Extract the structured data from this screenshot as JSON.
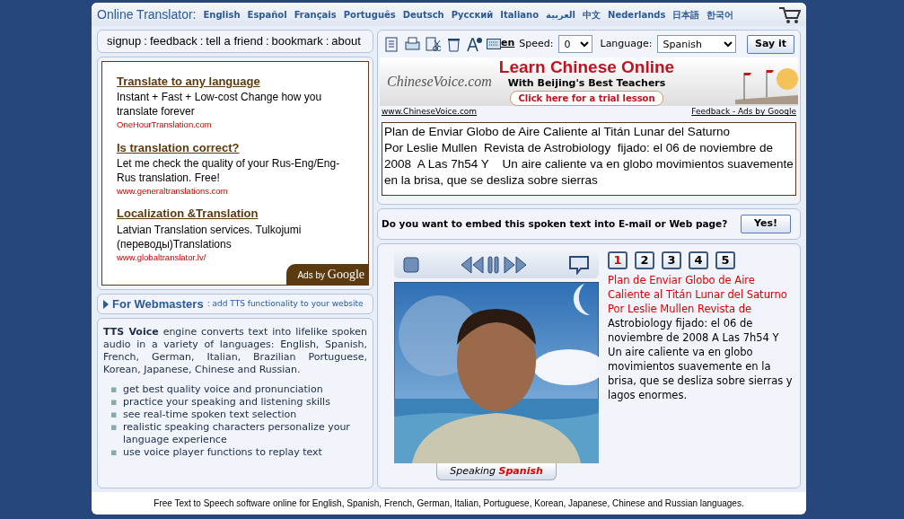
{
  "header": {
    "title": "Online Translator:",
    "languages": [
      "English",
      "Español",
      "Français",
      "Português",
      "Deutsch",
      "Русский",
      "Italiano",
      "العربية",
      "中文",
      "Nederlands",
      "日本語",
      "한국어"
    ]
  },
  "top_links": {
    "separator": ":",
    "items": [
      "signup",
      "feedback",
      "tell a friend",
      "bookmark",
      "about"
    ]
  },
  "ads": [
    {
      "title": "Translate to any language",
      "text": "Instant + Fast + Low-cost Change how you translate forever",
      "url": "OneHourTranslation.com"
    },
    {
      "title": "Is translation correct?",
      "text": "Let me check the quality of your Rus-Eng/Eng-Rus translation. Free!",
      "url": "www.generaltranslations.com"
    },
    {
      "title": "Localization &Translation",
      "text": "Latvian Translation services. Tulkojumi (переводы)Translations",
      "url": "www.globaltranslator.lv/"
    }
  ],
  "ads_badge": {
    "prefix": "Ads by",
    "brand": "Google"
  },
  "webmasters": {
    "title": "For Webmasters",
    "subtitle": ": add TTS functionality to your website"
  },
  "tts_info": {
    "intro": "**TTS Voice** engine converts text into lifelike spoken audio in a variety of languages: English, Spanish, French, German, Italian, Brazilian Portuguese, Korean, Japanese, Chinese and Russian.",
    "bullet": "▪",
    "features": [
      "get best quality voice and pronunciation",
      "practice your speaking and listening skills",
      "see real-time spoken text selection",
      "realistic speaking characters personalize your language experience",
      "use voice player functions to replay text"
    ]
  },
  "toolbar": {
    "keyboard_label": "en",
    "speed_label": "Speed:",
    "speed": "0",
    "language_label": "Language:",
    "language": "Spanish",
    "say_button": "Say it"
  },
  "banner": {
    "site": "ChineseVoice.com",
    "headline": "Learn Chinese Online",
    "tagline": "With Beijing's Best Teachers",
    "cta": "Click here for a trial lesson",
    "left_link": "www.ChineseVoice.com",
    "right_link": "Feedback - Ads by Google"
  },
  "text_input": {
    "value": "Plan de Enviar Globo de Aire Caliente al Titán Lunar del Saturno\nPor Leslie Mullen  Revista de Astrobiology  fijado: el 06 de noviembre de 2008  A Las 7h54 Y    Un aire caliente va en globo movimientos suavemente en la brisa, que se desliza sobre sierras"
  },
  "embed": {
    "question": "Do you want to embed this spoken text into E-mail or Web page?",
    "button": "Yes!"
  },
  "player": {
    "pages": [
      {
        "label": "1",
        "selected": true
      },
      {
        "label": "2",
        "selected": false
      },
      {
        "label": "3",
        "selected": false
      },
      {
        "label": "4",
        "selected": false
      },
      {
        "label": "5",
        "selected": false
      }
    ],
    "speaking_label": "Speaking",
    "speaking_language": "Spanish",
    "spoken_text": "Plan de Enviar Globo de Aire Caliente al Titán Lunar del Saturno Por Leslie Mullen Revista de",
    "remaining_text": "Astrobiology fijado: el 06 de noviembre de 2008 A Las 7h54 Y Un aire caliente va en globo movimientos suavemente en la brisa, que se desliza sobre sierras y lagos enormes."
  },
  "footer": "Free Text to Speech software online for English, Spanish, French, German, Italian, Portuguese, Korean, Japanese, Chinese and Russian languages."
}
